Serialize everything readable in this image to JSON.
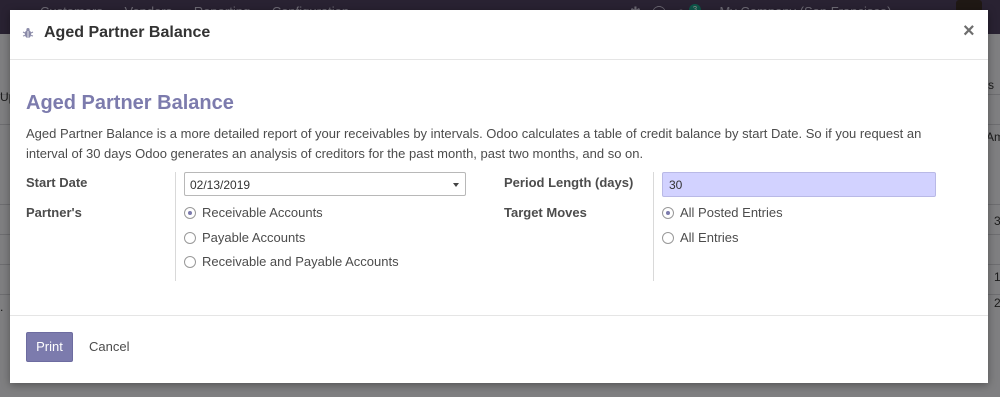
{
  "background": {
    "nav_menu": [
      "Customers",
      "Vendors",
      "Reporting",
      "Configuration"
    ],
    "company": "My Company (San Francisco)",
    "notification_count": "3",
    "left_fragments": [
      "Up",
      "."
    ],
    "right_fragments": [
      "s",
      "Am",
      "3",
      "1",
      "2"
    ]
  },
  "modal": {
    "title": "Aged Partner Balance",
    "report_heading": "Aged Partner Balance",
    "description": "Aged Partner Balance is a more detailed report of your receivables by intervals. Odoo calculates a table of credit balance by start Date. So if you request an interval of 30 days Odoo generates an analysis of creditors for the past month, past two months, and so on.",
    "start_date_label": "Start Date",
    "start_date_value": "02/13/2019",
    "partners_label": "Partner's",
    "partner_options": [
      {
        "label": "Receivable Accounts",
        "checked": true
      },
      {
        "label": "Payable Accounts",
        "checked": false
      },
      {
        "label": "Receivable and Payable Accounts",
        "checked": false
      }
    ],
    "period_length_label": "Period Length (days)",
    "period_length_value": "30",
    "target_moves_label": "Target Moves",
    "target_moves_options": [
      {
        "label": "All Posted Entries",
        "checked": true
      },
      {
        "label": "All Entries",
        "checked": false
      }
    ],
    "print_label": "Print",
    "cancel_label": "Cancel",
    "close_glyph": "×"
  },
  "colors": {
    "accent": "#7c7bad",
    "nav_bg": "#4b3f5c",
    "highlight_input": "#d2d2ff"
  }
}
